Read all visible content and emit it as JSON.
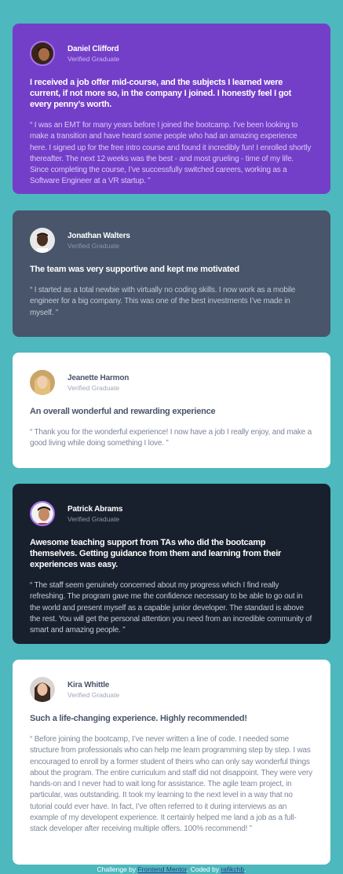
{
  "testimonials": [
    {
      "name": "Daniel Clifford",
      "status": "Verified Graduate",
      "headline": "I received a job offer mid-course, and the subjects I learned were current, if not more so, in the company I joined. I honestly feel I got every penny’s worth.",
      "quote": "“ I was an EMT for many years before I joined the bootcamp. I’ve been looking to make a transition and have heard some people who had an amazing experience here. I signed up for the free intro course and found it incredibly fun! I enrolled shortly thereafter. The next 12 weeks was the best - and most grueling - time of my life. Since completing the course, I’ve successfully switched careers, working as a Software Engineer at a VR startup. ”"
    },
    {
      "name": "Jonathan Walters",
      "status": "Verified Graduate",
      "headline": "The team was very supportive and kept me motivated",
      "quote": "“ I started as a total newbie with virtually no coding skills. I now work as a mobile engineer for a big company. This was one of the best investments I’ve made in myself. ”"
    },
    {
      "name": "Jeanette Harmon",
      "status": "Verified Graduate",
      "headline": "An overall wonderful and rewarding experience",
      "quote": "“ Thank you for the wonderful experience! I now have a job I really enjoy, and make a good living while doing something I love. ”"
    },
    {
      "name": "Patrick Abrams",
      "status": "Verified Graduate",
      "headline": "Awesome teaching support from TAs who did the bootcamp themselves. Getting guidance from them and learning from their experiences was easy.",
      "quote": "“ The staff seem genuinely concerned about my progress which I find really refreshing. The program gave me the confidence necessary to be able to go out in the world and present myself as a capable junior developer. The standard is above the rest. You will get the personal attention you need from an incredible community of smart and amazing people. ”"
    },
    {
      "name": "Kira Whittle",
      "status": "Verified Graduate",
      "headline": "Such a life-changing experience. Highly recommended!",
      "quote": "“ Before joining the bootcamp, I’ve never written a line of code. I needed some structure from professionals who can help me learn programming step by step. I was encouraged to enroll by a former student of theirs who can only say wonderful things about the program. The entire curriculum and staff did not disappoint. They were very hands-on and I never had to wait long for assistance. The agile team project, in particular, was outstanding. It took my learning to the next level in a way that no tutorial could ever have. In fact, I’ve often referred to it during interviews as an example of my developent experience. It certainly helped me land a job as a full-stack developer after receiving multiple offers. 100% recommend! ”"
    }
  ],
  "footer": {
    "prefix": "Challenge by ",
    "challenge_link": "Frontend Mentor",
    "middle": ". Coded by ",
    "author_link": "rafikchb",
    "suffix": "."
  },
  "colors": {
    "background": "#4db8bd",
    "purple_card": "#733fc8",
    "slate_card": "#48556a",
    "white_card": "#ffffff",
    "dark_card": "#19202d"
  },
  "icons": [
    "avatar-daniel-icon",
    "avatar-jonathan-icon",
    "avatar-jeanette-icon",
    "avatar-patrick-icon",
    "avatar-kira-icon"
  ]
}
